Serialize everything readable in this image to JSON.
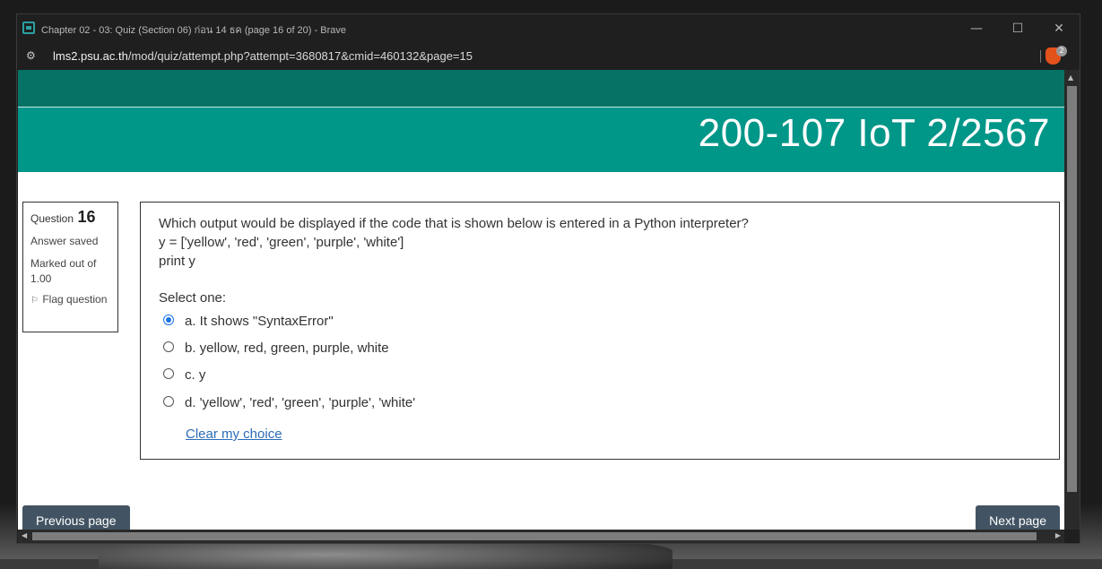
{
  "window": {
    "title": "Chapter 02 - 03: Quiz (Section 06) ก่อน 14 ธค (page 16 of 20) - Brave",
    "controls": {
      "minimize": "—",
      "maximize": "☐",
      "close": "✕"
    }
  },
  "browser": {
    "url_host": "lms2.psu.ac.th",
    "url_path": "/mod/quiz/attempt.php?attempt=3680817&cmid=460132&page=15",
    "shields_badge": "2"
  },
  "course": {
    "title": "200-107 IoT 2/2567"
  },
  "question_info": {
    "label": "Question",
    "number": "16",
    "state": "Answer saved",
    "marks": "Marked out of 1.00",
    "flag_label": "Flag question"
  },
  "question": {
    "lines": [
      "Which output would be displayed if the code that is shown below is entered in a Python interpreter?",
      "y = ['yellow', 'red', 'green', 'purple', 'white']",
      "print y"
    ],
    "prompt": "Select one:",
    "options": [
      {
        "label": "a. It shows \"SyntaxError\"",
        "selected": true
      },
      {
        "label": "b. yellow, red, green, purple, white",
        "selected": false
      },
      {
        "label": "c. y",
        "selected": false
      },
      {
        "label": "d. 'yellow', 'red', 'green', 'purple', 'white'",
        "selected": false
      }
    ],
    "clear_label": "Clear my choice"
  },
  "navigation": {
    "previous_label": "Previous page",
    "next_label": "Next page"
  },
  "colors": {
    "header_dark": "#067266",
    "header": "#009688",
    "nav_button": "#425463",
    "link": "#2b6cb7",
    "radio_selected": "#1a73e8"
  }
}
